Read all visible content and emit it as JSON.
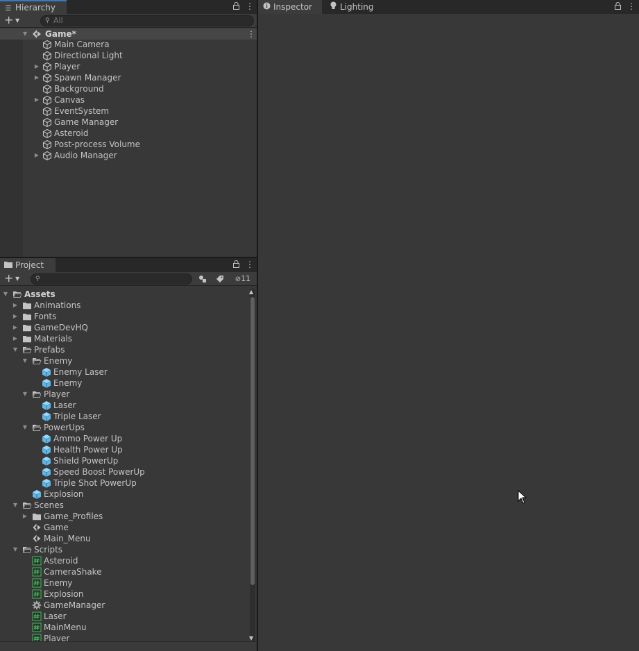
{
  "hierarchy": {
    "tab_label": "Hierarchy",
    "search_placeholder": "All",
    "scene_name": "Game*",
    "items": [
      {
        "label": "Main Camera",
        "expandable": false
      },
      {
        "label": "Directional Light",
        "expandable": false
      },
      {
        "label": "Player",
        "expandable": true
      },
      {
        "label": "Spawn Manager",
        "expandable": true
      },
      {
        "label": "Background",
        "expandable": false
      },
      {
        "label": "Canvas",
        "expandable": true
      },
      {
        "label": "EventSystem",
        "expandable": false
      },
      {
        "label": "Game Manager",
        "expandable": false
      },
      {
        "label": "Asteroid",
        "expandable": false
      },
      {
        "label": "Post-process Volume",
        "expandable": false
      },
      {
        "label": "Audio Manager",
        "expandable": true
      }
    ]
  },
  "project": {
    "tab_label": "Project",
    "search_placeholder": "",
    "hidden_count": "11",
    "tree": [
      {
        "label": "Assets",
        "depth": 0,
        "arrow": "open",
        "icon": "folder-open",
        "bold": true
      },
      {
        "label": "Animations",
        "depth": 1,
        "arrow": "closed",
        "icon": "folder"
      },
      {
        "label": "Fonts",
        "depth": 1,
        "arrow": "closed",
        "icon": "folder"
      },
      {
        "label": "GameDevHQ",
        "depth": 1,
        "arrow": "closed",
        "icon": "folder"
      },
      {
        "label": "Materials",
        "depth": 1,
        "arrow": "closed",
        "icon": "folder"
      },
      {
        "label": "Prefabs",
        "depth": 1,
        "arrow": "open",
        "icon": "folder-open"
      },
      {
        "label": "Enemy",
        "depth": 2,
        "arrow": "open",
        "icon": "folder-open"
      },
      {
        "label": "Enemy Laser",
        "depth": 3,
        "arrow": "none",
        "icon": "prefab"
      },
      {
        "label": "Enemy",
        "depth": 3,
        "arrow": "none",
        "icon": "prefab"
      },
      {
        "label": "Player",
        "depth": 2,
        "arrow": "open",
        "icon": "folder-open"
      },
      {
        "label": "Laser",
        "depth": 3,
        "arrow": "none",
        "icon": "prefab"
      },
      {
        "label": "Triple Laser",
        "depth": 3,
        "arrow": "none",
        "icon": "prefab"
      },
      {
        "label": "PowerUps",
        "depth": 2,
        "arrow": "open",
        "icon": "folder-open"
      },
      {
        "label": "Ammo Power Up",
        "depth": 3,
        "arrow": "none",
        "icon": "prefab"
      },
      {
        "label": "Health Power Up",
        "depth": 3,
        "arrow": "none",
        "icon": "prefab"
      },
      {
        "label": "Shield PowerUp",
        "depth": 3,
        "arrow": "none",
        "icon": "prefab"
      },
      {
        "label": "Speed Boost PowerUp",
        "depth": 3,
        "arrow": "none",
        "icon": "prefab"
      },
      {
        "label": "Triple Shot PowerUp",
        "depth": 3,
        "arrow": "none",
        "icon": "prefab"
      },
      {
        "label": "Explosion",
        "depth": 2,
        "arrow": "none",
        "icon": "prefab"
      },
      {
        "label": "Scenes",
        "depth": 1,
        "arrow": "open",
        "icon": "folder-open"
      },
      {
        "label": "Game_Profiles",
        "depth": 2,
        "arrow": "closed",
        "icon": "folder"
      },
      {
        "label": "Game",
        "depth": 2,
        "arrow": "none",
        "icon": "scene"
      },
      {
        "label": "Main_Menu",
        "depth": 2,
        "arrow": "none",
        "icon": "scene"
      },
      {
        "label": "Scripts",
        "depth": 1,
        "arrow": "open",
        "icon": "folder-open"
      },
      {
        "label": "Asteroid",
        "depth": 2,
        "arrow": "none",
        "icon": "script"
      },
      {
        "label": "CameraShake",
        "depth": 2,
        "arrow": "none",
        "icon": "script"
      },
      {
        "label": "Enemy",
        "depth": 2,
        "arrow": "none",
        "icon": "script"
      },
      {
        "label": "Explosion",
        "depth": 2,
        "arrow": "none",
        "icon": "script"
      },
      {
        "label": "GameManager",
        "depth": 2,
        "arrow": "none",
        "icon": "gear"
      },
      {
        "label": "Laser",
        "depth": 2,
        "arrow": "none",
        "icon": "script"
      },
      {
        "label": "MainMenu",
        "depth": 2,
        "arrow": "none",
        "icon": "script"
      },
      {
        "label": "Player",
        "depth": 2,
        "arrow": "none",
        "icon": "script"
      }
    ]
  },
  "inspector": {
    "tabs": [
      {
        "label": "Inspector",
        "icon": "info-icon"
      },
      {
        "label": "Lighting",
        "icon": "bulb-icon"
      }
    ]
  },
  "colors": {
    "accent": "#3a79bb",
    "prefab": "#5fb7e8",
    "script": "#3fbf5a"
  }
}
